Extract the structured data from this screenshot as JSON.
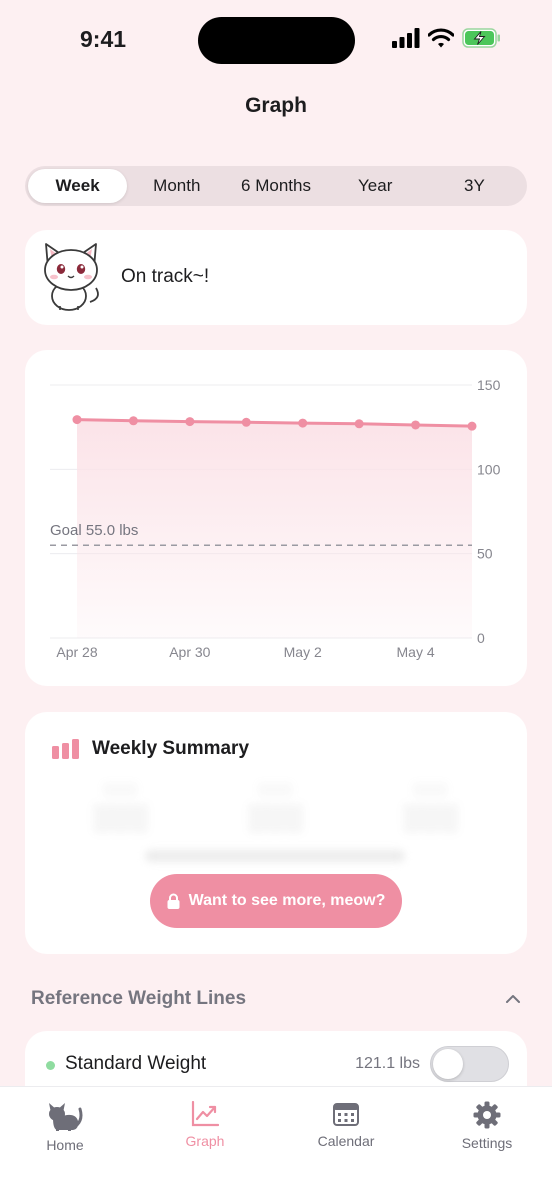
{
  "status_bar": {
    "time": "9:41"
  },
  "nav": {
    "title": "Graph"
  },
  "range_tabs": [
    "Week",
    "Month",
    "6 Months",
    "Year",
    "3Y"
  ],
  "active_range": "Week",
  "status_card": {
    "message": "On track~!"
  },
  "chart_data": {
    "type": "area",
    "x": [
      "Apr 28",
      "Apr 29",
      "Apr 30",
      "May 1",
      "May 2",
      "May 3",
      "May 4",
      "May 5"
    ],
    "x_tick_labels": [
      "Apr 28",
      "Apr 30",
      "May 2",
      "May 4"
    ],
    "values": [
      129.5,
      128.8,
      128.3,
      127.9,
      127.4,
      127.0,
      126.3,
      125.6
    ],
    "y_ticks": [
      "150",
      "100",
      "50",
      "0"
    ],
    "ylim": [
      0,
      150
    ],
    "goal": {
      "value": 55.0,
      "label": "Goal 55.0 lbs"
    },
    "grid": true,
    "line_color": "#ef8fa3",
    "fill_color": "#fbe3e8",
    "goal_color": "#9a9aa2"
  },
  "summary": {
    "title": "Weekly Summary",
    "upsell_button": "Want to see more, meow?"
  },
  "reference": {
    "header": "Reference Weight Lines",
    "items": [
      {
        "label": "Standard Weight",
        "value": "121.1 lbs",
        "enabled": false,
        "dot_color": "#8fdca0"
      }
    ]
  },
  "tabbar": {
    "items": [
      {
        "label": "Home",
        "icon": "cat-icon"
      },
      {
        "label": "Graph",
        "icon": "chart-icon"
      },
      {
        "label": "Calendar",
        "icon": "calendar-icon"
      },
      {
        "label": "Settings",
        "icon": "gear-icon"
      }
    ],
    "active": "Graph"
  },
  "colors": {
    "accent": "#ef8fa3",
    "background": "#fdf0f2"
  }
}
